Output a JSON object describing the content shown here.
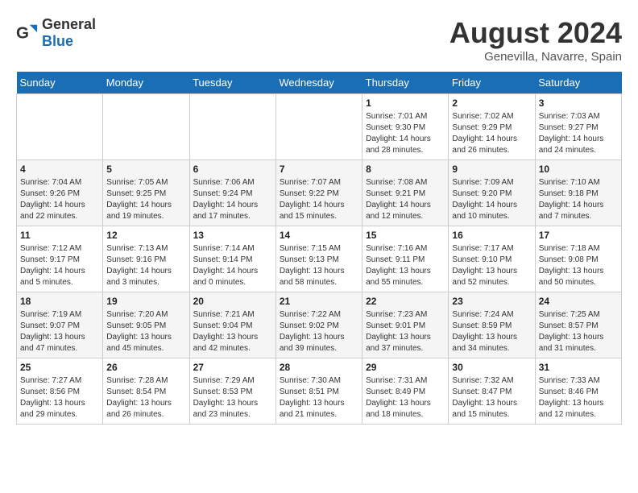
{
  "header": {
    "logo_general": "General",
    "logo_blue": "Blue",
    "month_year": "August 2024",
    "location": "Genevilla, Navarre, Spain"
  },
  "days_of_week": [
    "Sunday",
    "Monday",
    "Tuesday",
    "Wednesday",
    "Thursday",
    "Friday",
    "Saturday"
  ],
  "weeks": [
    [
      {
        "day": "",
        "sunrise": "",
        "sunset": "",
        "daylight": ""
      },
      {
        "day": "",
        "sunrise": "",
        "sunset": "",
        "daylight": ""
      },
      {
        "day": "",
        "sunrise": "",
        "sunset": "",
        "daylight": ""
      },
      {
        "day": "",
        "sunrise": "",
        "sunset": "",
        "daylight": ""
      },
      {
        "day": "1",
        "sunrise": "Sunrise: 7:01 AM",
        "sunset": "Sunset: 9:30 PM",
        "daylight": "Daylight: 14 hours and 28 minutes."
      },
      {
        "day": "2",
        "sunrise": "Sunrise: 7:02 AM",
        "sunset": "Sunset: 9:29 PM",
        "daylight": "Daylight: 14 hours and 26 minutes."
      },
      {
        "day": "3",
        "sunrise": "Sunrise: 7:03 AM",
        "sunset": "Sunset: 9:27 PM",
        "daylight": "Daylight: 14 hours and 24 minutes."
      }
    ],
    [
      {
        "day": "4",
        "sunrise": "Sunrise: 7:04 AM",
        "sunset": "Sunset: 9:26 PM",
        "daylight": "Daylight: 14 hours and 22 minutes."
      },
      {
        "day": "5",
        "sunrise": "Sunrise: 7:05 AM",
        "sunset": "Sunset: 9:25 PM",
        "daylight": "Daylight: 14 hours and 19 minutes."
      },
      {
        "day": "6",
        "sunrise": "Sunrise: 7:06 AM",
        "sunset": "Sunset: 9:24 PM",
        "daylight": "Daylight: 14 hours and 17 minutes."
      },
      {
        "day": "7",
        "sunrise": "Sunrise: 7:07 AM",
        "sunset": "Sunset: 9:22 PM",
        "daylight": "Daylight: 14 hours and 15 minutes."
      },
      {
        "day": "8",
        "sunrise": "Sunrise: 7:08 AM",
        "sunset": "Sunset: 9:21 PM",
        "daylight": "Daylight: 14 hours and 12 minutes."
      },
      {
        "day": "9",
        "sunrise": "Sunrise: 7:09 AM",
        "sunset": "Sunset: 9:20 PM",
        "daylight": "Daylight: 14 hours and 10 minutes."
      },
      {
        "day": "10",
        "sunrise": "Sunrise: 7:10 AM",
        "sunset": "Sunset: 9:18 PM",
        "daylight": "Daylight: 14 hours and 7 minutes."
      }
    ],
    [
      {
        "day": "11",
        "sunrise": "Sunrise: 7:12 AM",
        "sunset": "Sunset: 9:17 PM",
        "daylight": "Daylight: 14 hours and 5 minutes."
      },
      {
        "day": "12",
        "sunrise": "Sunrise: 7:13 AM",
        "sunset": "Sunset: 9:16 PM",
        "daylight": "Daylight: 14 hours and 3 minutes."
      },
      {
        "day": "13",
        "sunrise": "Sunrise: 7:14 AM",
        "sunset": "Sunset: 9:14 PM",
        "daylight": "Daylight: 14 hours and 0 minutes."
      },
      {
        "day": "14",
        "sunrise": "Sunrise: 7:15 AM",
        "sunset": "Sunset: 9:13 PM",
        "daylight": "Daylight: 13 hours and 58 minutes."
      },
      {
        "day": "15",
        "sunrise": "Sunrise: 7:16 AM",
        "sunset": "Sunset: 9:11 PM",
        "daylight": "Daylight: 13 hours and 55 minutes."
      },
      {
        "day": "16",
        "sunrise": "Sunrise: 7:17 AM",
        "sunset": "Sunset: 9:10 PM",
        "daylight": "Daylight: 13 hours and 52 minutes."
      },
      {
        "day": "17",
        "sunrise": "Sunrise: 7:18 AM",
        "sunset": "Sunset: 9:08 PM",
        "daylight": "Daylight: 13 hours and 50 minutes."
      }
    ],
    [
      {
        "day": "18",
        "sunrise": "Sunrise: 7:19 AM",
        "sunset": "Sunset: 9:07 PM",
        "daylight": "Daylight: 13 hours and 47 minutes."
      },
      {
        "day": "19",
        "sunrise": "Sunrise: 7:20 AM",
        "sunset": "Sunset: 9:05 PM",
        "daylight": "Daylight: 13 hours and 45 minutes."
      },
      {
        "day": "20",
        "sunrise": "Sunrise: 7:21 AM",
        "sunset": "Sunset: 9:04 PM",
        "daylight": "Daylight: 13 hours and 42 minutes."
      },
      {
        "day": "21",
        "sunrise": "Sunrise: 7:22 AM",
        "sunset": "Sunset: 9:02 PM",
        "daylight": "Daylight: 13 hours and 39 minutes."
      },
      {
        "day": "22",
        "sunrise": "Sunrise: 7:23 AM",
        "sunset": "Sunset: 9:01 PM",
        "daylight": "Daylight: 13 hours and 37 minutes."
      },
      {
        "day": "23",
        "sunrise": "Sunrise: 7:24 AM",
        "sunset": "Sunset: 8:59 PM",
        "daylight": "Daylight: 13 hours and 34 minutes."
      },
      {
        "day": "24",
        "sunrise": "Sunrise: 7:25 AM",
        "sunset": "Sunset: 8:57 PM",
        "daylight": "Daylight: 13 hours and 31 minutes."
      }
    ],
    [
      {
        "day": "25",
        "sunrise": "Sunrise: 7:27 AM",
        "sunset": "Sunset: 8:56 PM",
        "daylight": "Daylight: 13 hours and 29 minutes."
      },
      {
        "day": "26",
        "sunrise": "Sunrise: 7:28 AM",
        "sunset": "Sunset: 8:54 PM",
        "daylight": "Daylight: 13 hours and 26 minutes."
      },
      {
        "day": "27",
        "sunrise": "Sunrise: 7:29 AM",
        "sunset": "Sunset: 8:53 PM",
        "daylight": "Daylight: 13 hours and 23 minutes."
      },
      {
        "day": "28",
        "sunrise": "Sunrise: 7:30 AM",
        "sunset": "Sunset: 8:51 PM",
        "daylight": "Daylight: 13 hours and 21 minutes."
      },
      {
        "day": "29",
        "sunrise": "Sunrise: 7:31 AM",
        "sunset": "Sunset: 8:49 PM",
        "daylight": "Daylight: 13 hours and 18 minutes."
      },
      {
        "day": "30",
        "sunrise": "Sunrise: 7:32 AM",
        "sunset": "Sunset: 8:47 PM",
        "daylight": "Daylight: 13 hours and 15 minutes."
      },
      {
        "day": "31",
        "sunrise": "Sunrise: 7:33 AM",
        "sunset": "Sunset: 8:46 PM",
        "daylight": "Daylight: 13 hours and 12 minutes."
      }
    ]
  ]
}
